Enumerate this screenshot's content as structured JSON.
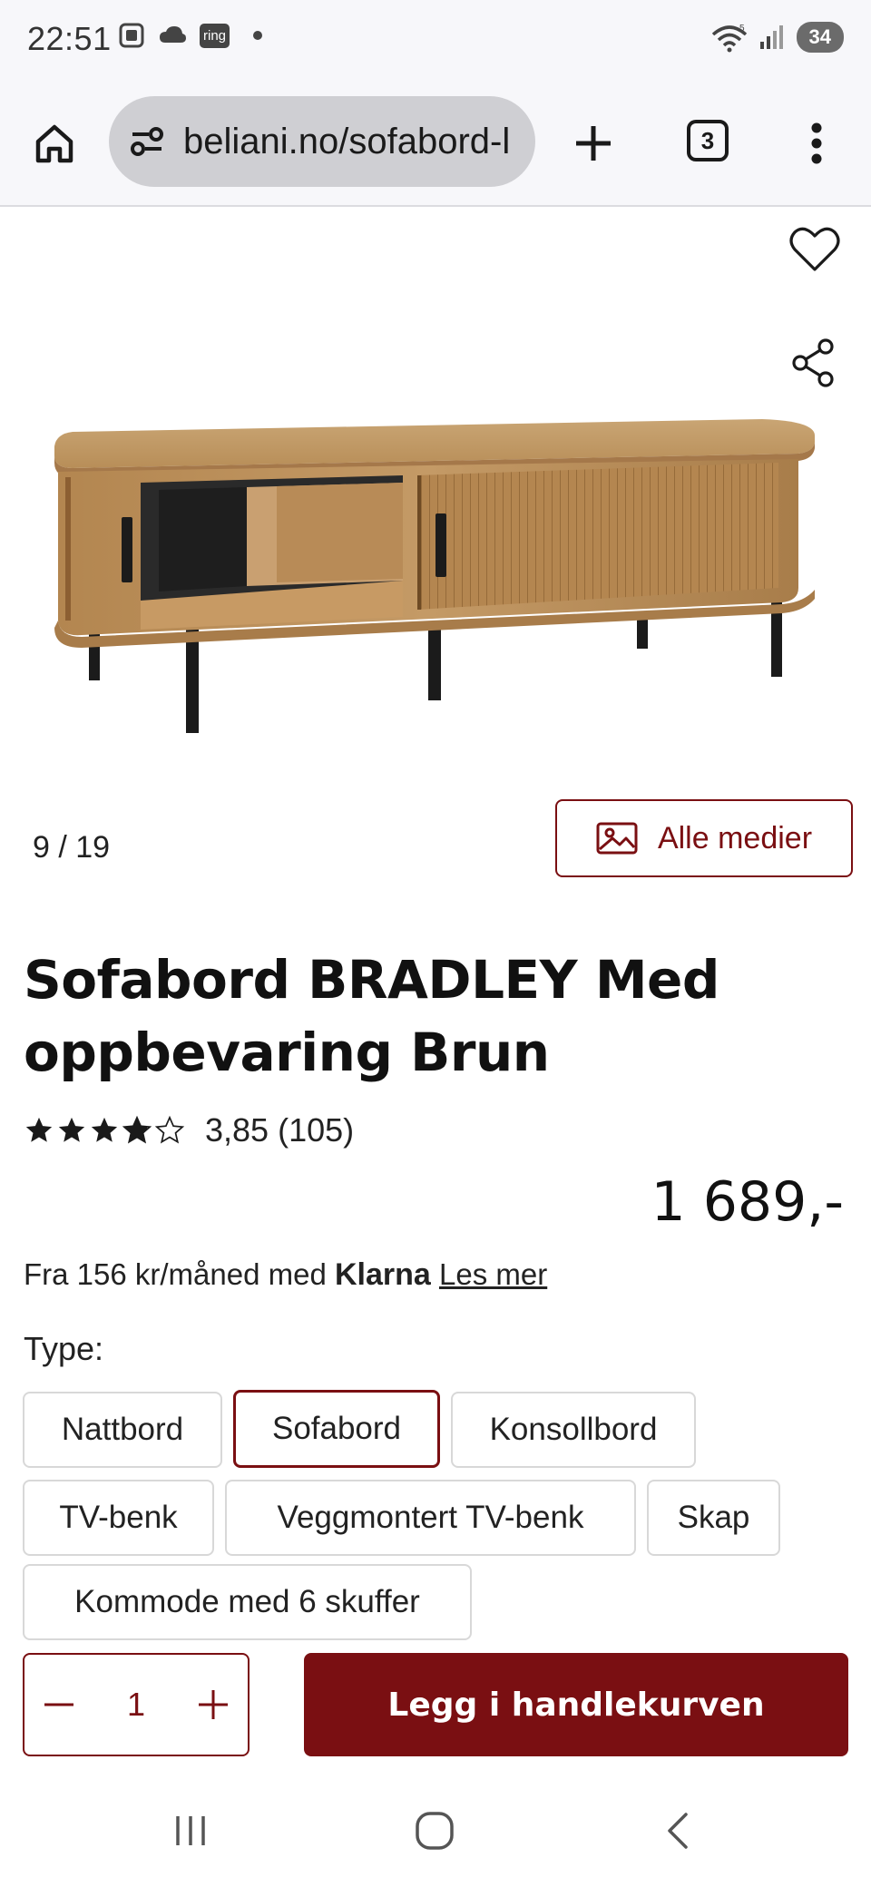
{
  "status_bar": {
    "time": "22:51",
    "ring_label": "ring",
    "wifi_label": "5",
    "battery": "34"
  },
  "browser": {
    "url": "beliani.no/sofabord-l",
    "tab_count": "3"
  },
  "media": {
    "counter": "9 / 19",
    "all_media_label": "Alle medier"
  },
  "product": {
    "title": "Sofabord BRADLEY Med oppbevaring Brun",
    "rating_value": "3,85",
    "rating_count": "(105)",
    "rating_fraction": 0.77,
    "price": "1 689,-",
    "klarna_prefix": "Fra 156 kr/måned med",
    "klarna_brand": "Klarna",
    "klarna_link": "Les mer"
  },
  "type_selector": {
    "label": "Type:",
    "options": [
      "Nattbord",
      "Sofabord",
      "Konsollbord",
      "TV-benk",
      "Veggmontert TV-benk",
      "Skap",
      "Kommode med 6 skuffer"
    ],
    "selected": "Sofabord"
  },
  "purchase": {
    "quantity": "1",
    "add_to_cart_label": "Legg i handlekurven"
  },
  "colors": {
    "accent": "#7a0f12",
    "browser_bg": "#f7f7fa",
    "url_pill": "#cfcfd3"
  }
}
